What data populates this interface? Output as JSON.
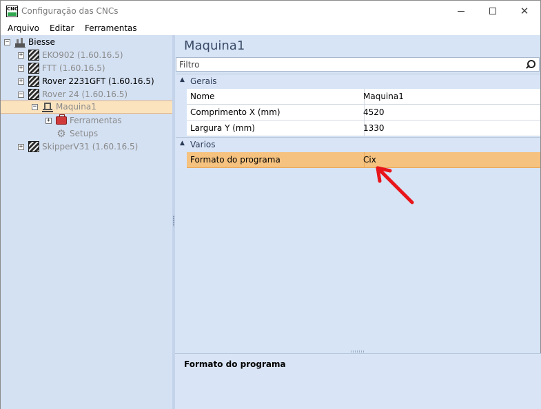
{
  "window": {
    "title": "Configuração das CNCs",
    "app_icon_text": "CNC",
    "controls": [
      "minimize",
      "maximize",
      "close"
    ]
  },
  "menu": {
    "items": [
      "Arquivo",
      "Editar",
      "Ferramentas"
    ]
  },
  "tree": {
    "root": {
      "label": "Biesse",
      "icon": "factory-icon",
      "toggle": "−"
    },
    "nodes": [
      {
        "label": "EKO902 (1.60.16.5)",
        "icon": "machine-stripe-icon",
        "toggle": "+",
        "muted": true
      },
      {
        "label": "FTT (1.60.16.5)",
        "icon": "machine-stripe-icon",
        "toggle": "+",
        "muted": true
      },
      {
        "label": "Rover 2231GFT (1.60.16.5)",
        "icon": "machine-stripe-icon",
        "toggle": "+",
        "muted": false
      },
      {
        "label": "Rover 24 (1.60.16.5)",
        "icon": "machine-stripe-icon",
        "toggle": "−",
        "muted": true
      }
    ],
    "selected_node": {
      "label": "Maquina1",
      "icon": "machine-icon",
      "toggle": "−"
    },
    "children": [
      {
        "label": "Ferramentas",
        "icon": "toolbox-icon",
        "toggle": "+"
      },
      {
        "label": "Setups",
        "icon": "gear-icon",
        "toggle": ""
      }
    ],
    "last_node": {
      "label": "SkipperV31 (1.60.16.5)",
      "icon": "machine-stripe-icon",
      "toggle": "+",
      "muted": true
    }
  },
  "properties": {
    "title": "Maquina1",
    "filter_placeholder": "Filtro",
    "categories": [
      {
        "label": "Gerais",
        "expanded": true,
        "rows": [
          {
            "name": "Nome",
            "value": "Maquina1"
          },
          {
            "name": "Comprimento X (mm)",
            "value": "4520"
          },
          {
            "name": "Largura Y (mm)",
            "value": "1330"
          }
        ]
      },
      {
        "label": "Varios",
        "expanded": true,
        "rows": [
          {
            "name": "Formato do programa",
            "value": "Cix",
            "selected": true
          }
        ]
      }
    ],
    "description_title": "Formato do programa"
  },
  "colors": {
    "tree_background": "#d4e1f3",
    "selection": "#f5c27f",
    "annotation_arrow": "#e8161b"
  }
}
